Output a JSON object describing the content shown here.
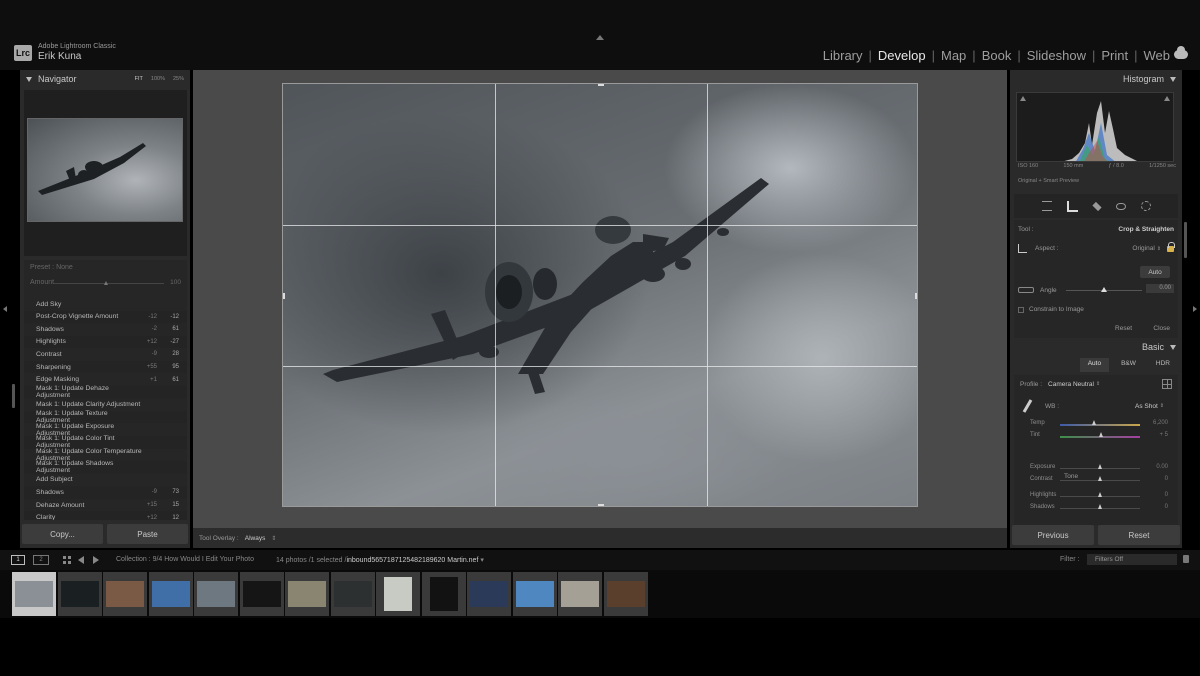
{
  "titlebar": {
    "app_name": "Adobe Lightroom Classic",
    "user_name": "Erik Kuna",
    "logo": "Lrc",
    "modules": [
      "Library",
      "Develop",
      "Map",
      "Book",
      "Slideshow",
      "Print",
      "Web"
    ],
    "active_module": "Develop",
    "icons": [
      "cloud-icon"
    ]
  },
  "navigator": {
    "title": "Navigator",
    "zoom_options": [
      "FIT",
      "100%",
      "25%"
    ]
  },
  "mask_area": {
    "preset": "Preset : None",
    "amount_label": "Amount",
    "amount_value": "100"
  },
  "history": {
    "items": [
      {
        "label": "Add Sky",
        "before": "",
        "after": ""
      },
      {
        "label": "Post-Crop Vignette Amount",
        "before": "-12",
        "after": "-12"
      },
      {
        "label": "Shadows",
        "before": "-2",
        "after": "61"
      },
      {
        "label": "Highlights",
        "before": "+12",
        "after": "-27"
      },
      {
        "label": "Contrast",
        "before": "-9",
        "after": "28"
      },
      {
        "label": "Sharpening",
        "before": "+55",
        "after": "95"
      },
      {
        "label": "Edge Masking",
        "before": "+1",
        "after": "61"
      },
      {
        "label": "Mask 1: Update Dehaze Adjustment",
        "before": "",
        "after": ""
      },
      {
        "label": "Mask 1: Update Clarity Adjustment",
        "before": "",
        "after": ""
      },
      {
        "label": "Mask 1: Update Texture Adjustment",
        "before": "",
        "after": ""
      },
      {
        "label": "Mask 1: Update Exposure Adjustment",
        "before": "",
        "after": ""
      },
      {
        "label": "Mask 1: Update Color Tint Adjustment",
        "before": "",
        "after": ""
      },
      {
        "label": "Mask 1: Update Color Temperature Adjustment",
        "before": "",
        "after": ""
      },
      {
        "label": "Mask 1: Update Shadows Adjustment",
        "before": "",
        "after": ""
      },
      {
        "label": "Add Subject",
        "before": "",
        "after": ""
      },
      {
        "label": "Shadows",
        "before": "-9",
        "after": "73"
      },
      {
        "label": "Dehaze Amount",
        "before": "+15",
        "after": "15"
      },
      {
        "label": "Clarity",
        "before": "+12",
        "after": "12"
      }
    ]
  },
  "left_buttons": {
    "copy": "Copy...",
    "paste": "Paste"
  },
  "toolbar": {
    "tool_overlay_label": "Tool Overlay :",
    "tool_overlay_value": "Always"
  },
  "histogram": {
    "title": "Histogram",
    "iso": "ISO 160",
    "focal": "150 mm",
    "aperture": "ƒ / 8.0",
    "shutter": "1/1250 sec",
    "preview_note": "Original + Smart Preview"
  },
  "crop": {
    "tool_label": "Tool :",
    "tool_name": "Crop & Straighten",
    "aspect_label": "Aspect :",
    "aspect_value": "Original",
    "auto_label": "Auto",
    "angle_label": "Angle",
    "angle_value": "0.00",
    "angle_fraction": 0.5,
    "constrain_label": "Constrain to Image",
    "reset_label": "Reset",
    "close_label": "Close"
  },
  "basic": {
    "title": "Basic",
    "treatments": [
      "Auto",
      "B&W",
      "HDR"
    ],
    "profile_label": "Profile :",
    "profile_value": "Camera Neutral",
    "wb_label": "WB :",
    "wb_value": "As Shot",
    "tone_label": "Tone",
    "sliders": [
      {
        "label": "Temp",
        "value": "6,200",
        "fraction": 0.43
      },
      {
        "label": "Tint",
        "value": "+ 5",
        "fraction": 0.52
      },
      {
        "label": "Exposure",
        "value": "0.00",
        "fraction": 0.5
      },
      {
        "label": "Contrast",
        "value": "0",
        "fraction": 0.5
      },
      {
        "label": "Highlights",
        "value": "0",
        "fraction": 0.5
      },
      {
        "label": "Shadows",
        "value": "0",
        "fraction": 0.5
      }
    ]
  },
  "right_buttons": {
    "previous": "Previous",
    "reset": "Reset"
  },
  "filmbar": {
    "view_primary": "1",
    "view_secondary": "2",
    "collection": "Collection : 9/4 How Would I Edit Your Photo",
    "count": "14 photos /1 selected /",
    "filename": "inbound5657187125482189620 Martin.nef",
    "filter_label": "Filter :",
    "filter_value": "Filters Off"
  },
  "filmstrip": {
    "thumbs": [
      {
        "color": "#8a9096",
        "selected": true,
        "tall": false
      },
      {
        "color": "#1a1f22",
        "selected": false,
        "tall": false
      },
      {
        "color": "#7a5a45",
        "selected": false,
        "tall": false
      },
      {
        "color": "#3f6fa6",
        "selected": false,
        "tall": false
      },
      {
        "color": "#6e7880",
        "selected": false,
        "tall": false
      },
      {
        "color": "#151515",
        "selected": false,
        "tall": false
      },
      {
        "color": "#8a8570",
        "selected": false,
        "tall": false
      },
      {
        "color": "#2d3030",
        "selected": false,
        "tall": false
      },
      {
        "color": "#c7cbc4",
        "selected": false,
        "tall": true
      },
      {
        "color": "#121212",
        "selected": false,
        "tall": true
      },
      {
        "color": "#2c3a5a",
        "selected": false,
        "tall": false
      },
      {
        "color": "#4f88c0",
        "selected": false,
        "tall": false
      },
      {
        "color": "#a4a096",
        "selected": false,
        "tall": false
      },
      {
        "color": "#5a3f2c",
        "selected": false,
        "tall": false
      }
    ]
  }
}
